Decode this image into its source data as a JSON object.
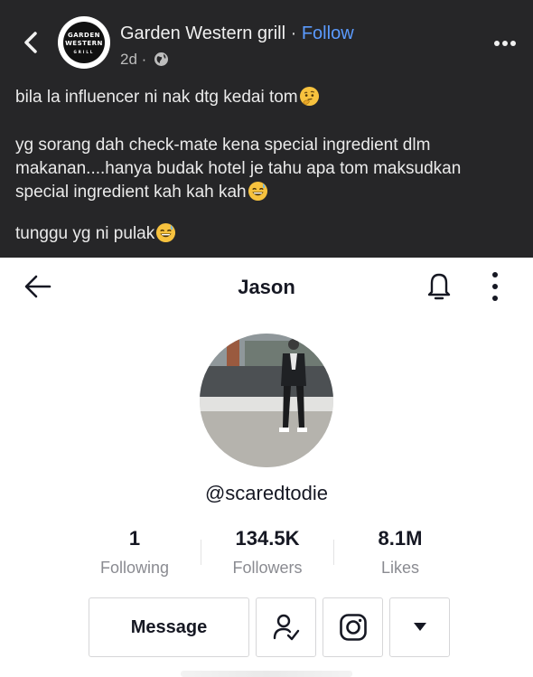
{
  "post": {
    "page_name": "Garden Western grill",
    "separator": "·",
    "follow_label": "Follow",
    "time": "2d ·",
    "logo": {
      "line1": "GARDEN",
      "line2": "WESTERN",
      "line3": "GRILL"
    },
    "lines": [
      "bila la influencer ni nak dtg kedai tom",
      "yg sorang dah check-mate kena special ingredient dlm",
      "makanan....hanya budak hotel je tahu apa tom maksudkan",
      "special ingredient kah kah kah",
      "tunggu yg ni pulak"
    ],
    "icons": [
      "back-chevron-icon",
      "globe-icon",
      "more-dots-icon",
      "thinking-face-emoji",
      "grinning-sweat-emoji"
    ]
  },
  "profile": {
    "title": "Jason",
    "handle": "@scaredtodie",
    "stats": [
      {
        "value": "1",
        "label": "Following"
      },
      {
        "value": "134.5K",
        "label": "Followers"
      },
      {
        "value": "8.1M",
        "label": "Likes"
      }
    ],
    "message_label": "Message",
    "icons": [
      "back-arrow-icon",
      "bell-icon",
      "kebab-menu-icon",
      "add-friend-icon",
      "instagram-icon",
      "dropdown-arrow-icon"
    ]
  },
  "colors": {
    "facebook_bg": "#262628",
    "follow_link": "#5b9bff",
    "tiktok_text": "#161823",
    "muted_label": "#8a8b91"
  }
}
